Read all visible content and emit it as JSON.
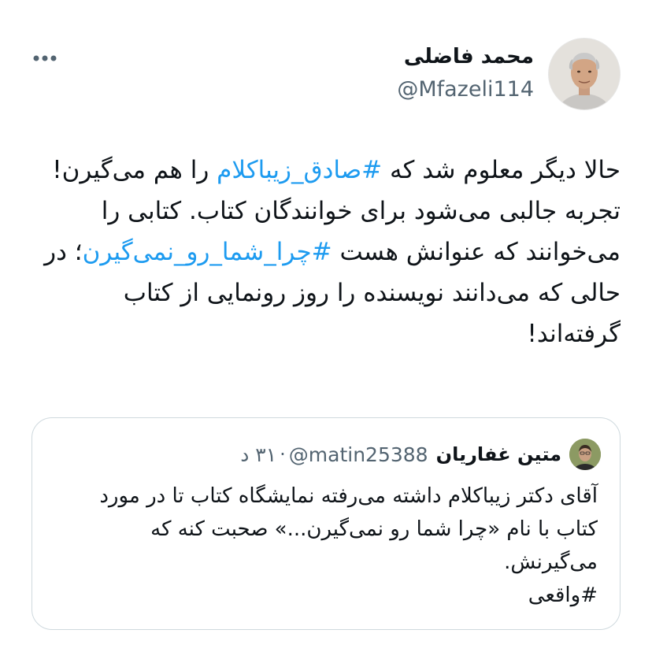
{
  "author": {
    "display_name": "محمد فاضلی",
    "handle": "@Mfazeli114"
  },
  "tweet": {
    "line1_pre": "حالا دیگر معلوم شد که ",
    "hashtag1": "#صادق_زیباکلام",
    "line1_post": " را هم می‌گیرن!",
    "line2": "تجربه جالبی می‌شود برای خوانندگان کتاب. کتابی را می‌خوانند که عنوانش هست ",
    "hashtag2": "#چرا_شما_رو_نمی‌گیرن",
    "line2_post": "؛ در حالی که می‌دانند نویسنده را روز رونمایی از کتاب گرفته‌اند!"
  },
  "quote": {
    "display_name": "متین غفاریان",
    "handle": "@matin25388",
    "separator": "·",
    "time": "۳۱ د",
    "text": "آقای دکتر زیباکلام داشته می‌رفته نمایشگاه کتاب تا در مورد کتاب با نام «چرا شما رو نمی‌گیرن...» صحبت کنه که می‌گیرنش.",
    "hashtag": "#واقعی"
  },
  "icons": {
    "more": "more-horizontal-icon"
  },
  "colors": {
    "link": "#1d9bf0",
    "secondary": "#536471",
    "border": "#cfd9de"
  }
}
